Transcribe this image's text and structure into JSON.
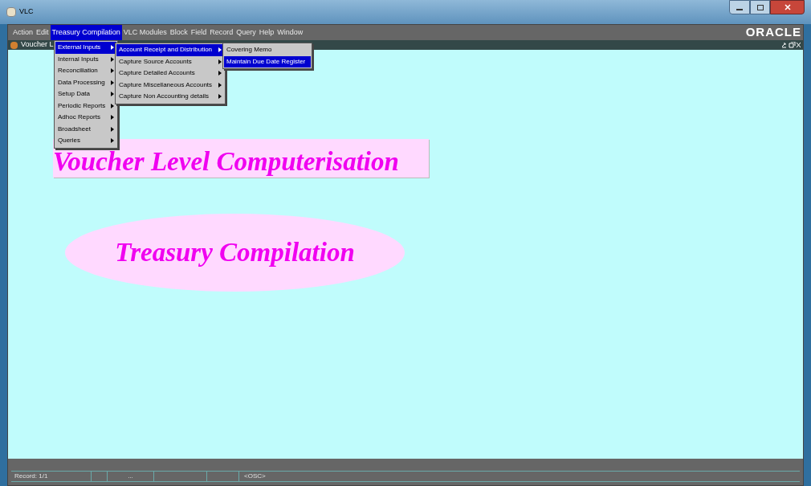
{
  "window": {
    "title": "VLC"
  },
  "menubar": [
    {
      "label": "Action",
      "selected": false
    },
    {
      "label": "Edit",
      "selected": false
    },
    {
      "label": "Treasury Compilation",
      "selected": true
    },
    {
      "label": "VLC Modules",
      "selected": false
    },
    {
      "label": "Block",
      "selected": false
    },
    {
      "label": "Field",
      "selected": false
    },
    {
      "label": "Record",
      "selected": false
    },
    {
      "label": "Query",
      "selected": false
    },
    {
      "label": "Help",
      "selected": false
    },
    {
      "label": "Window",
      "selected": false
    }
  ],
  "brand": "ORACLE",
  "inner_window": {
    "title": "Voucher L"
  },
  "menus": [
    [
      {
        "label": "External Inputs",
        "selected": true,
        "submenu": true
      },
      {
        "label": "Internal Inputs",
        "selected": false,
        "submenu": true
      },
      {
        "label": "Reconciliation",
        "selected": false,
        "submenu": true
      },
      {
        "label": "Data Processing",
        "selected": false,
        "submenu": true
      },
      {
        "label": "Setup Data",
        "selected": false,
        "submenu": true
      },
      {
        "label": "Periodic Reports",
        "selected": false,
        "submenu": true
      },
      {
        "label": "Adhoc Reports",
        "selected": false,
        "submenu": true
      },
      {
        "label": "Broadsheet",
        "selected": false,
        "submenu": true
      },
      {
        "label": "Queries",
        "selected": false,
        "submenu": true
      }
    ],
    [
      {
        "label": "Account Receipt and Distribution",
        "selected": true,
        "submenu": true
      },
      {
        "label": "Capture Source Accounts",
        "selected": false,
        "submenu": true
      },
      {
        "label": "Capture Detailed Accounts",
        "selected": false,
        "submenu": true
      },
      {
        "label": "Capture Miscellaneous Accounts",
        "selected": false,
        "submenu": true
      },
      {
        "label": "Capture Non Accounting details",
        "selected": false,
        "submenu": true
      }
    ],
    [
      {
        "label": "Covering Memo",
        "selected": false,
        "submenu": false
      },
      {
        "label": "Maintain Due Date Register",
        "selected": true,
        "submenu": false
      }
    ]
  ],
  "banner": "Voucher Level Computerisation",
  "subtitle": "Treasury Compilation",
  "status_bar": {
    "record": "Record: 1/1",
    "ellipsis": "...",
    "mode": "<OSC>"
  }
}
